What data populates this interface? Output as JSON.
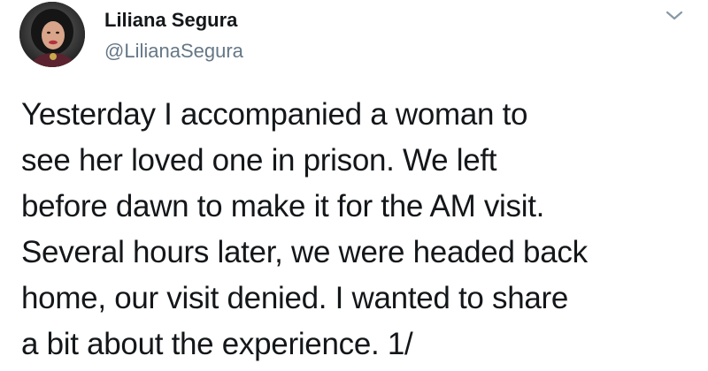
{
  "tweet": {
    "author": {
      "display_name": "Liliana Segura",
      "handle": "@LilianaSegura",
      "avatar_icon": "profile-photo"
    },
    "menu_icon": "chevron-down-icon",
    "text_lines": [
      "Yesterday I accompanied a woman to",
      "see her loved one in prison. We left",
      "before dawn to make it for the AM visit.",
      "Several hours later, we were headed back",
      "home, our visit denied. I wanted to share",
      "a bit about the experience. 1/"
    ]
  },
  "colors": {
    "text": "#14171a",
    "secondary_text": "#657786",
    "chevron": "#8899a6",
    "background": "#ffffff"
  }
}
